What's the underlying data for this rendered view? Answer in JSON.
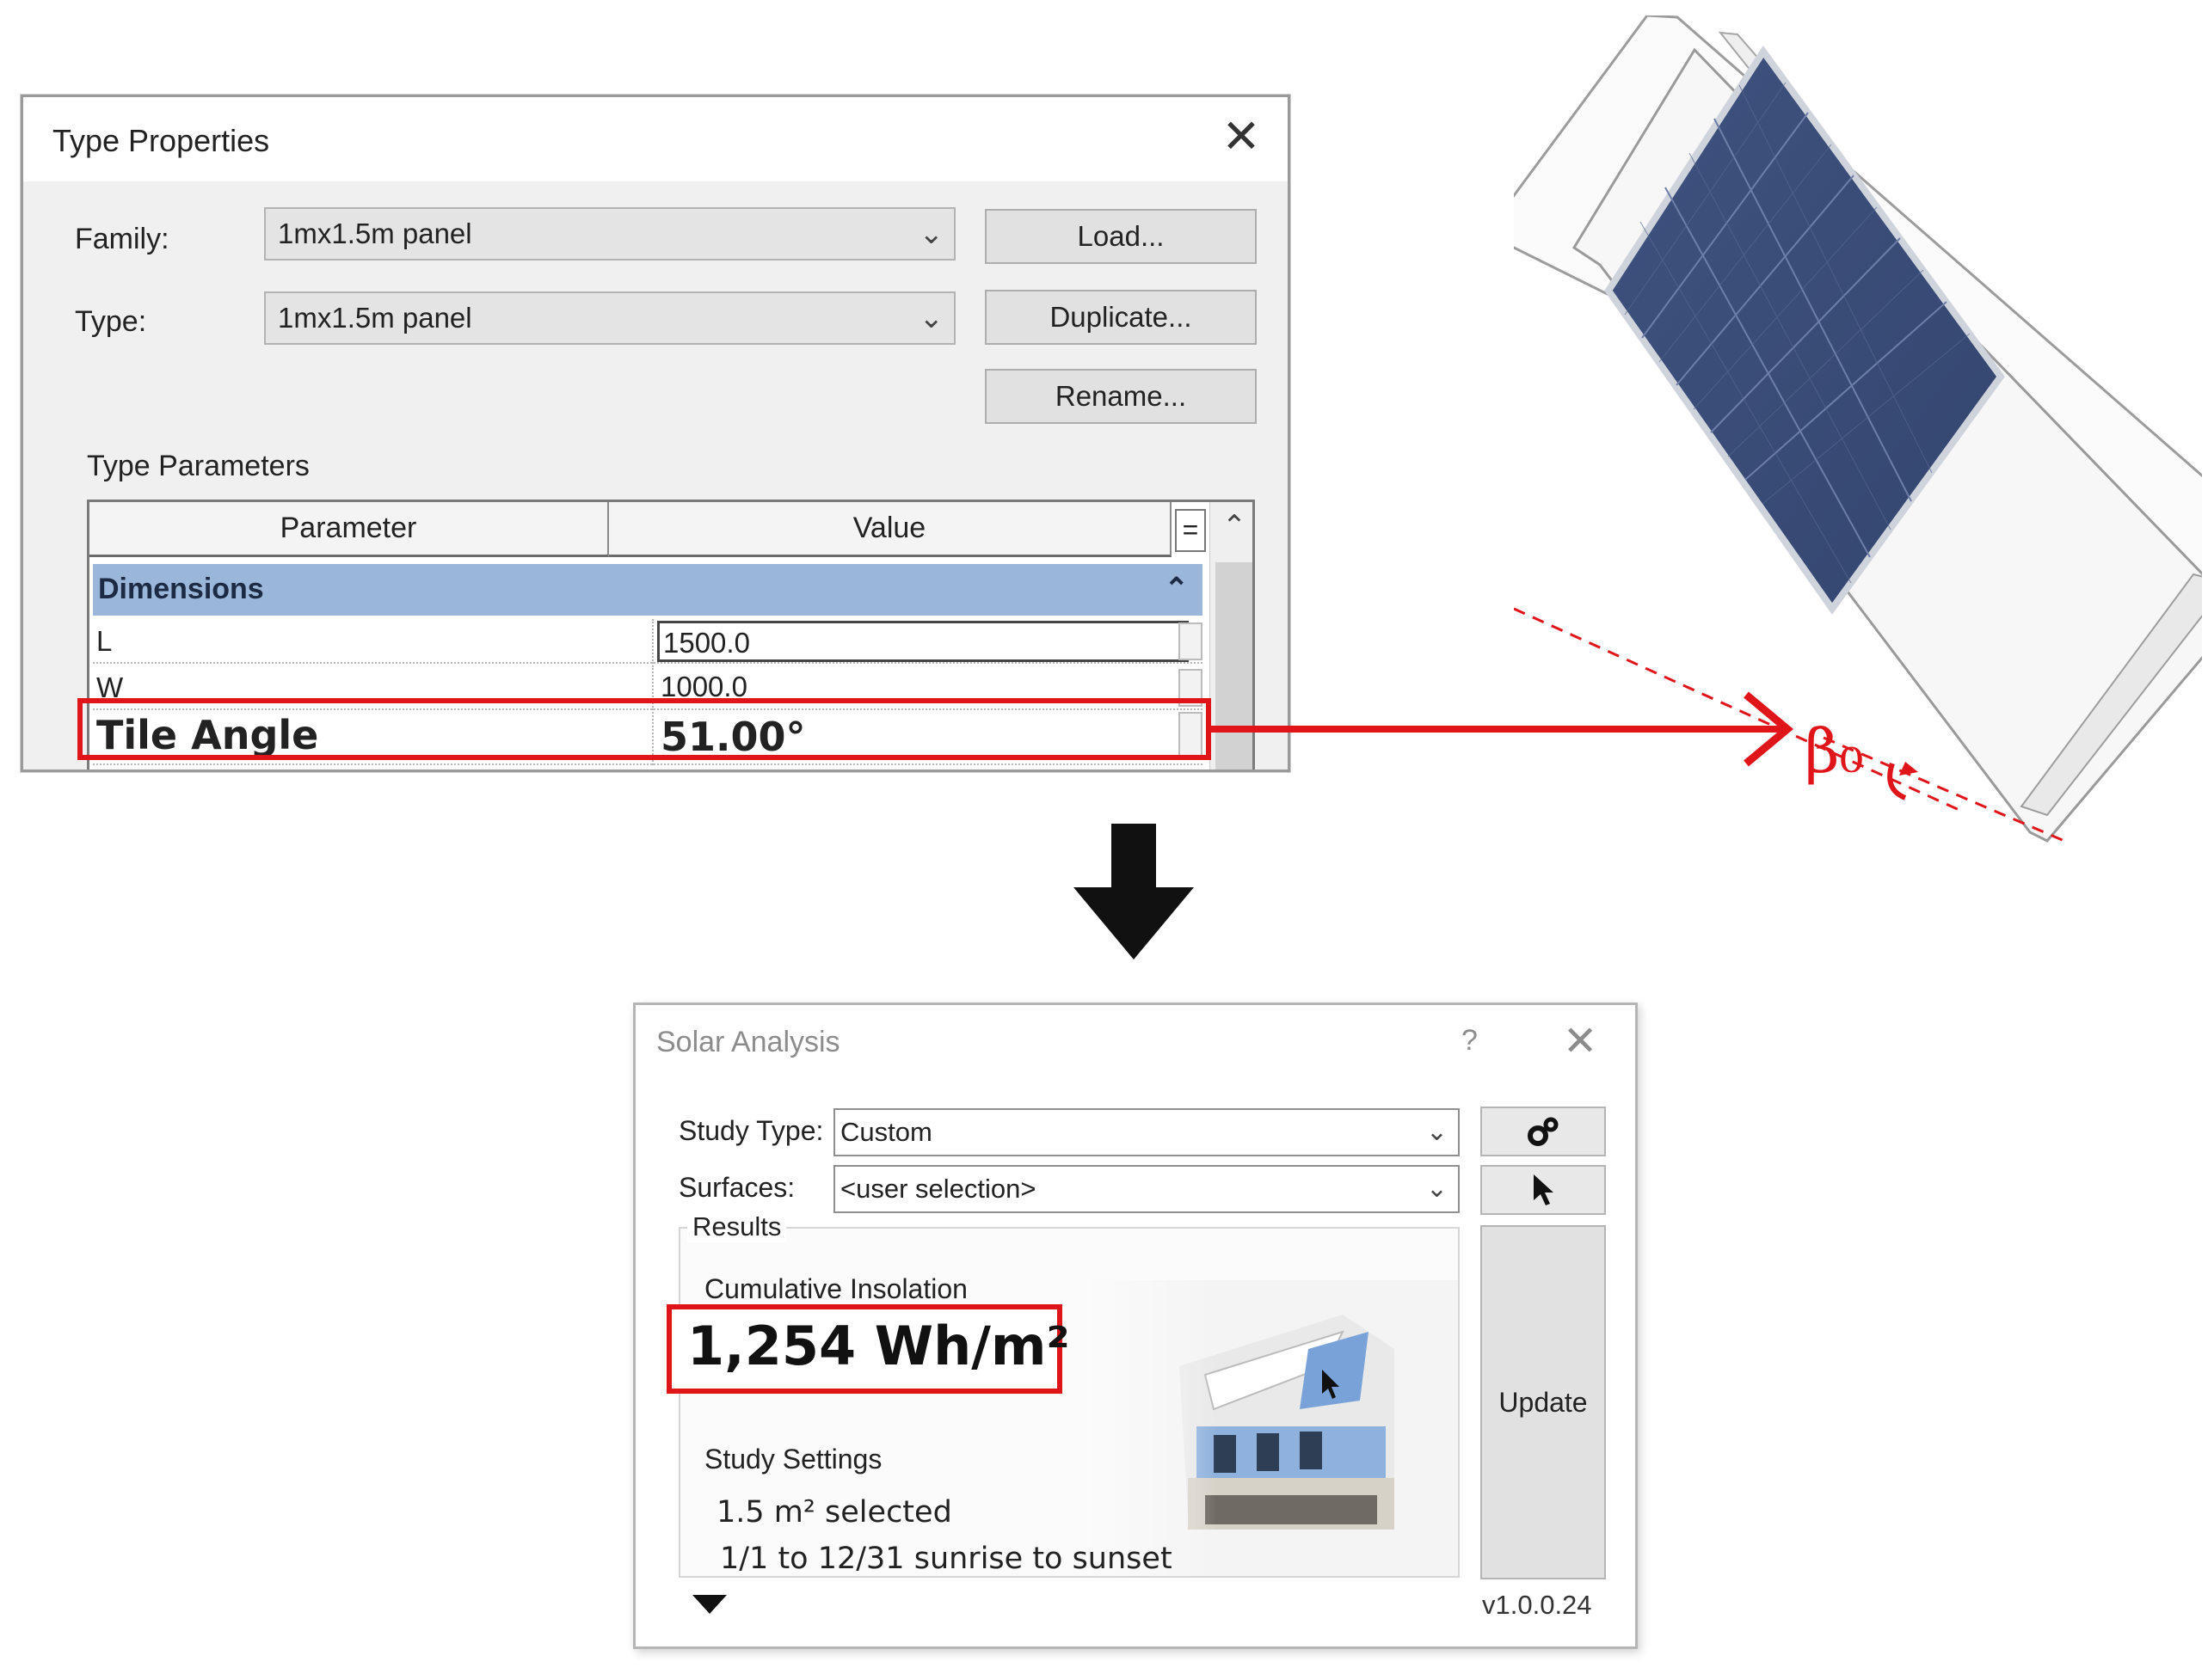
{
  "type_properties": {
    "title": "Type Properties",
    "family_label": "Family:",
    "family_value": "1mx1.5m panel",
    "type_label": "Type:",
    "type_value": "1mx1.5m panel",
    "buttons": {
      "load": "Load...",
      "duplicate": "Duplicate...",
      "rename": "Rename..."
    },
    "section_label": "Type Parameters",
    "columns": {
      "parameter": "Parameter",
      "value": "Value",
      "equals": "="
    },
    "group": "Dimensions",
    "rows": [
      {
        "name": "L",
        "value": "1500.0"
      },
      {
        "name": "W",
        "value": "1000.0"
      },
      {
        "name": "Tile Angle",
        "value": "51.00°"
      }
    ]
  },
  "illustration": {
    "angle_label": "β₀",
    "highlight_color": "#e0151a"
  },
  "solar_analysis": {
    "title": "Solar Analysis",
    "help": "?",
    "study_type_label": "Study Type:",
    "study_type_value": "Custom",
    "surfaces_label": "Surfaces:",
    "surfaces_value": "<user selection>",
    "results_label": "Results",
    "cumulative_label": "Cumulative Insolation",
    "insolation_value": "1,254 Wh/m²",
    "study_settings_label": "Study Settings",
    "area_selected": "1.5 m² selected",
    "date_range": "1/1 to 12/31 sunrise to sunset",
    "update_label": "Update",
    "version": "v1.0.0.24",
    "icons": [
      "settings-gears-icon",
      "cursor-pointer-icon",
      "expand-down-icon"
    ]
  }
}
